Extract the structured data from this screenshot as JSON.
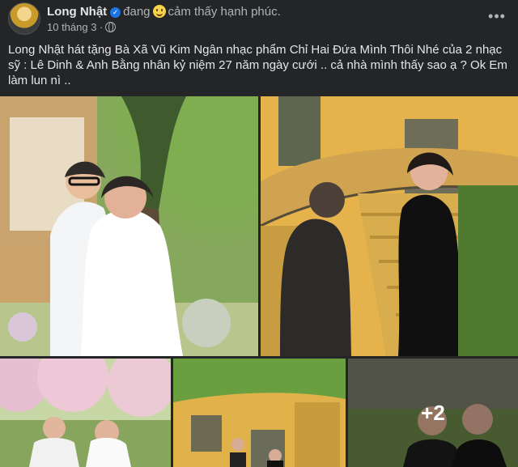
{
  "post": {
    "author": "Long Nhật",
    "feeling_prefix": "đang",
    "feeling": "cảm thấy hạnh phúc.",
    "timestamp": "10 tháng 3 ·",
    "privacy_icon": "globe-icon",
    "more_icon": "more-options-icon",
    "text": "Long Nhật hát tặng Bà Xã Vũ Kim Ngân nhạc phẩm Chỉ Hai Đứa Mình Thôi Nhé của 2  nhạc sỹ : Lê Dinh & Anh Bằng nhân kỷ niệm 27 năm ngày cưới .. cả nhà mình thấy sao ạ ? Ok Em làm lun nì .."
  },
  "gallery": {
    "extra_count": "+2"
  },
  "colors": {
    "background": "#242526",
    "text": "#e4e6eb",
    "secondary_text": "#b0b3b8",
    "verified": "#1b74e4"
  }
}
